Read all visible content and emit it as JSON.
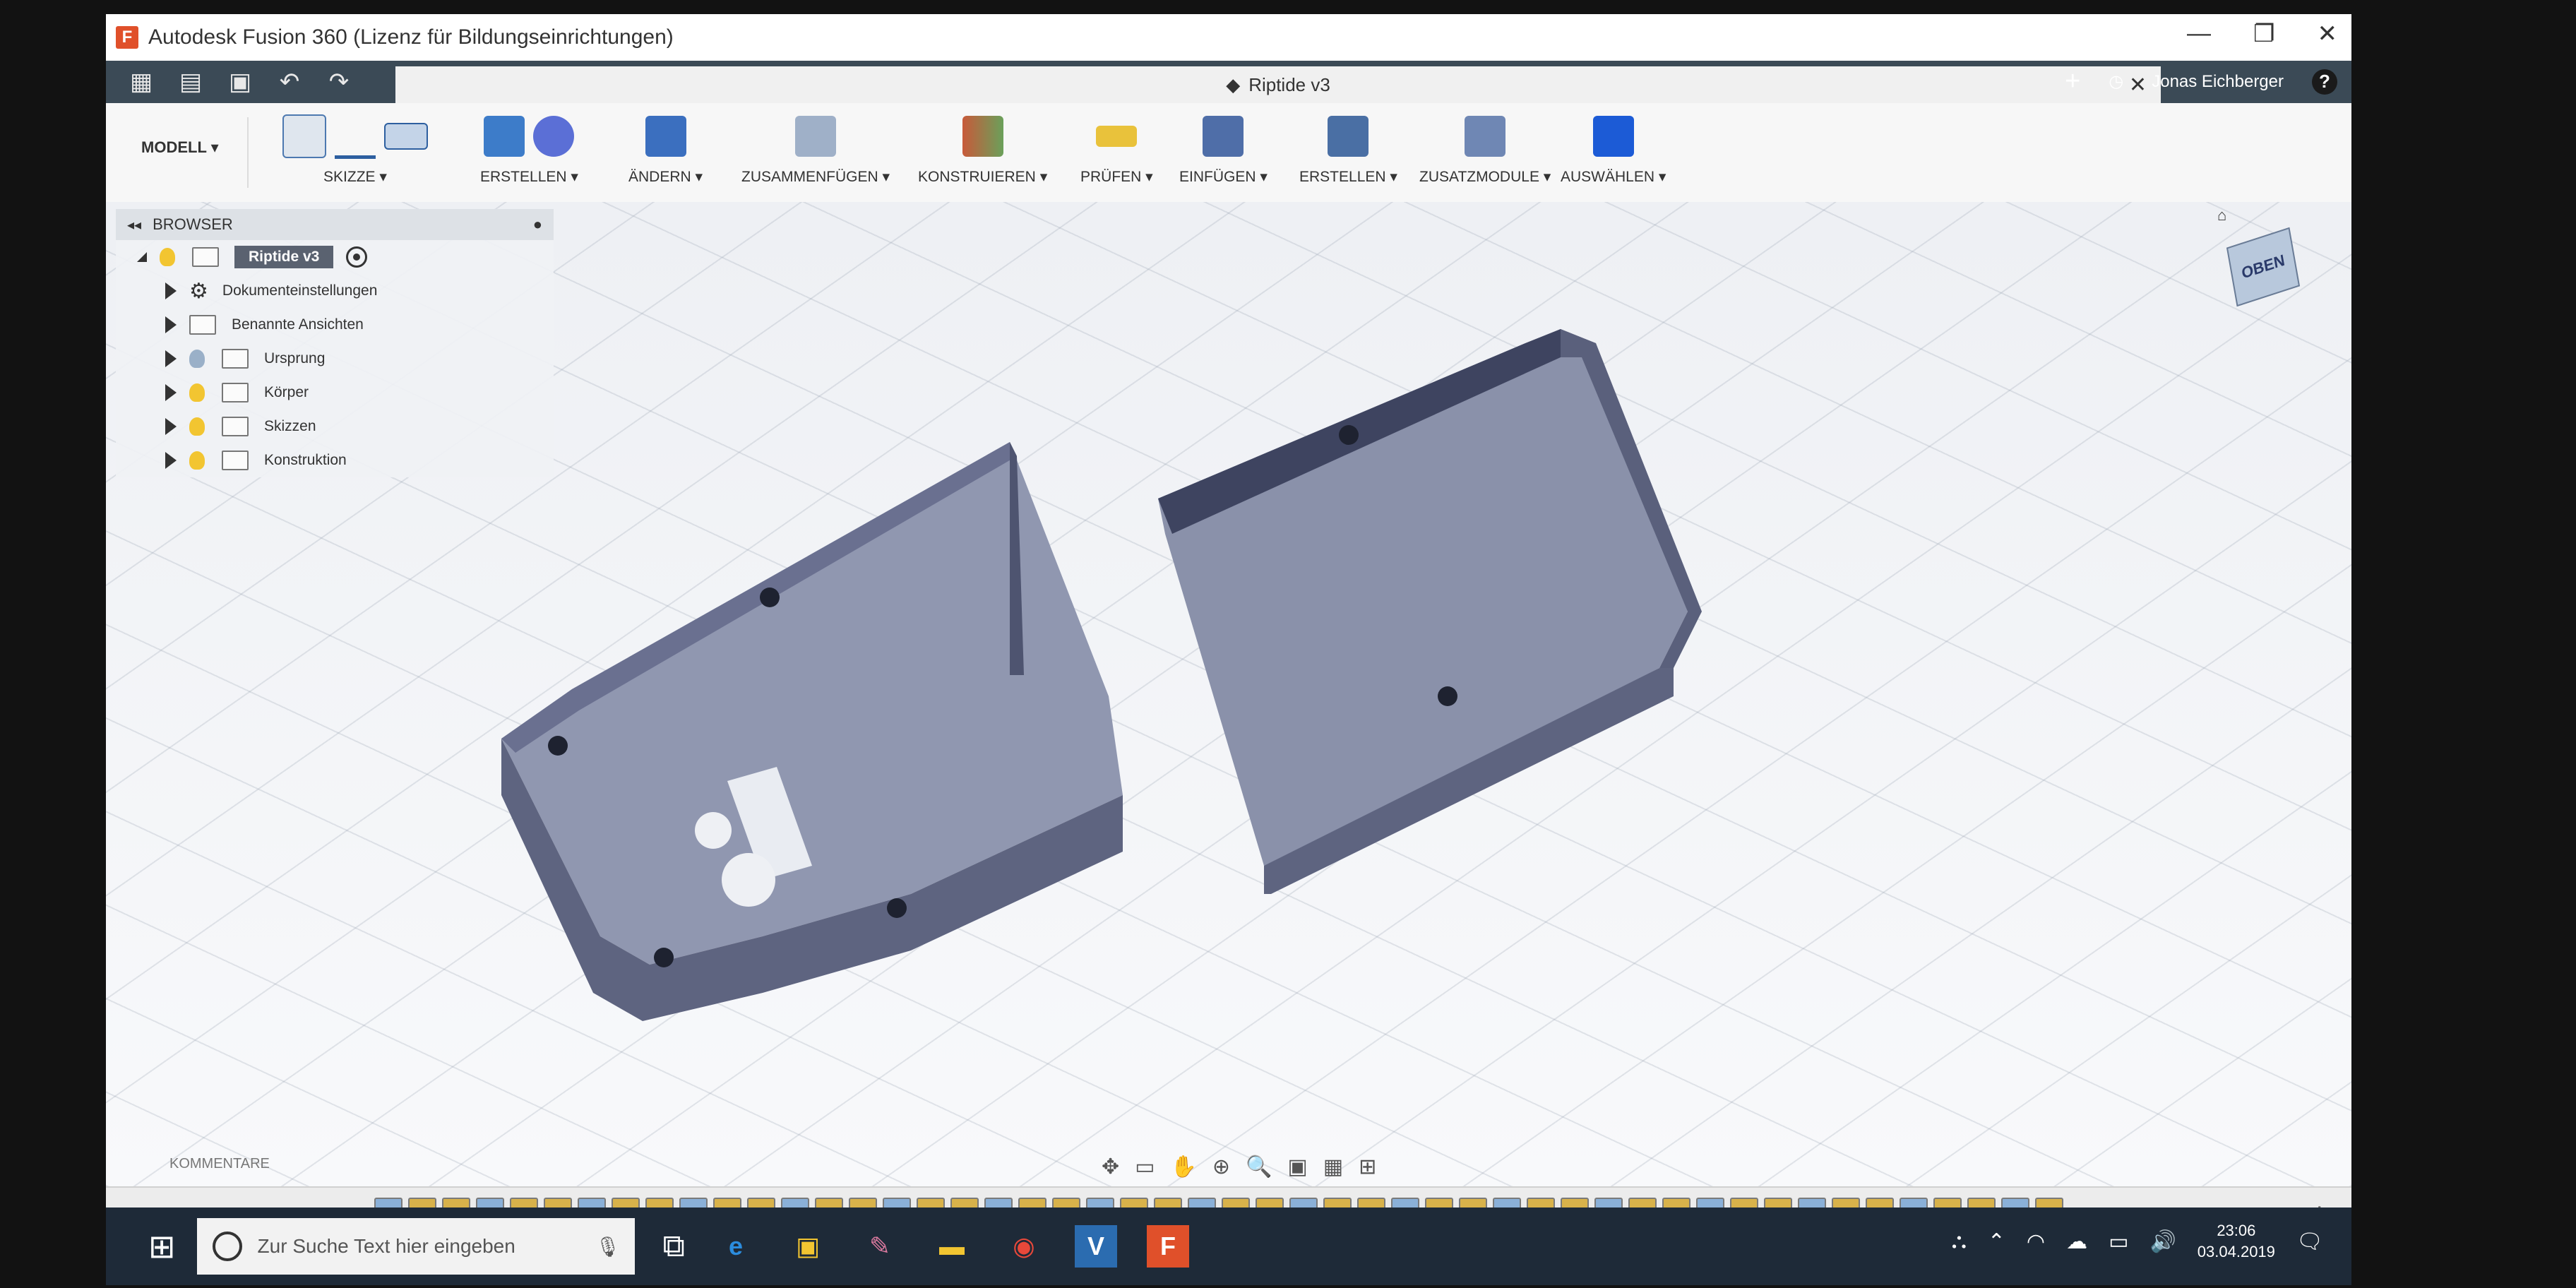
{
  "window": {
    "title": "Autodesk Fusion 360 (Lizenz für Bildungseinrichtungen)",
    "app_icon_letter": "F"
  },
  "quickbar": {
    "document_title": "Riptide v3",
    "user": "Jonas Eichberger",
    "help": "?"
  },
  "toolbar": {
    "workspace": "MODELL",
    "groups": [
      {
        "label": "SKIZZE"
      },
      {
        "label": "ERSTELLEN"
      },
      {
        "label": "ÄNDERN"
      },
      {
        "label": "ZUSAMMENFÜGEN"
      },
      {
        "label": "KONSTRUIEREN"
      },
      {
        "label": "PRÜFEN"
      },
      {
        "label": "EINFÜGEN"
      },
      {
        "label": "ERSTELLEN"
      },
      {
        "label": "ZUSATZMODULE"
      },
      {
        "label": "AUSWÄHLEN"
      }
    ]
  },
  "browser": {
    "title": "BROWSER",
    "root": "Riptide v3",
    "items": [
      {
        "label": "Dokumenteinstellungen",
        "type": "settings"
      },
      {
        "label": "Benannte Ansichten",
        "type": "folder"
      },
      {
        "label": "Ursprung",
        "type": "folder-bulb"
      },
      {
        "label": "Körper",
        "type": "folder-bulb"
      },
      {
        "label": "Skizzen",
        "type": "folder-bulb"
      },
      {
        "label": "Konstruktion",
        "type": "folder-bulb"
      }
    ]
  },
  "viewcube": {
    "face": "OBEN"
  },
  "comments": {
    "label": "KOMMENTARE"
  },
  "taskbar": {
    "search_placeholder": "Zur Suche Text hier eingeben",
    "time": "23:06",
    "date": "03.04.2019"
  },
  "colors": {
    "model_fill": "#8d94ad",
    "model_dark": "#5e6480",
    "ribbon_bg": "#f7f7f7",
    "quickbar_bg": "#3b4a56",
    "taskbar_bg": "#1e2a38"
  }
}
